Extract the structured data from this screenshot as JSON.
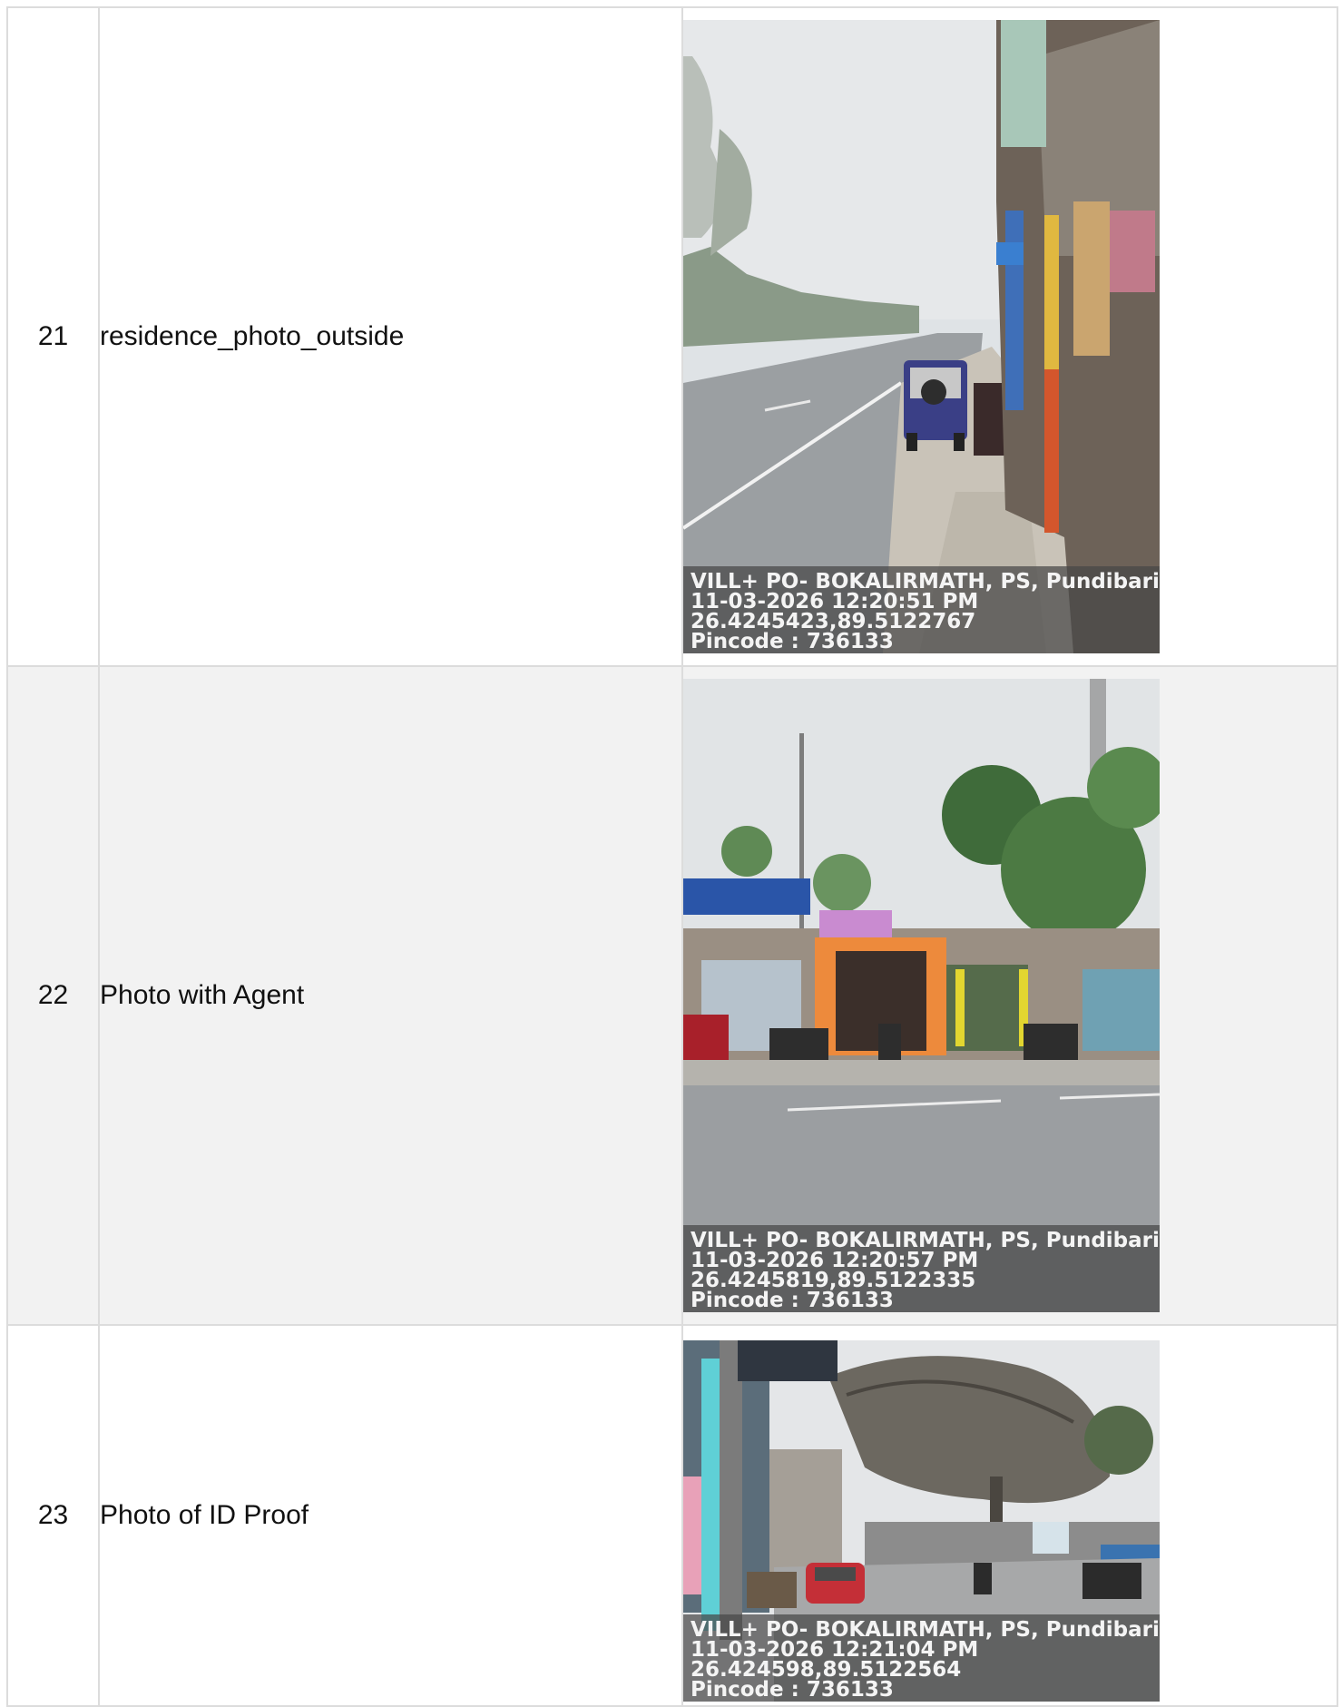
{
  "rows": [
    {
      "no": "21",
      "label": "residence_photo_outside",
      "photo": {
        "icon": "street-photo",
        "overlay": {
          "address": "VILL+ PO- BOKALIRMATH, PS, Pundibari, Ba",
          "datetime": "11-03-2026 12:20:51 PM",
          "coords": "26.4245423,89.5122767",
          "pincode": "Pincode : 736133"
        }
      }
    },
    {
      "no": "22",
      "label": "Photo with Agent",
      "photo": {
        "icon": "shopfront-photo",
        "overlay": {
          "address": "VILL+ PO- BOKALIRMATH, PS, Pundibari, Ba",
          "datetime": "11-03-2026 12:20:57 PM",
          "coords": "26.4245819,89.5122335",
          "pincode": "Pincode : 736133"
        }
      }
    },
    {
      "no": "23",
      "label": "Photo of ID Proof",
      "photo": {
        "icon": "market-street-photo",
        "overlay": {
          "address": "VILL+ PO- BOKALIRMATH, PS, Pundibari, Ba",
          "datetime": "11-03-2026 12:21:04 PM",
          "coords": "26.424598,89.5122564",
          "pincode": "Pincode : 736133"
        }
      }
    }
  ],
  "colors": {
    "border": "#dcdcdc",
    "shade": "#f2f2f2",
    "overlay": "#464646"
  }
}
